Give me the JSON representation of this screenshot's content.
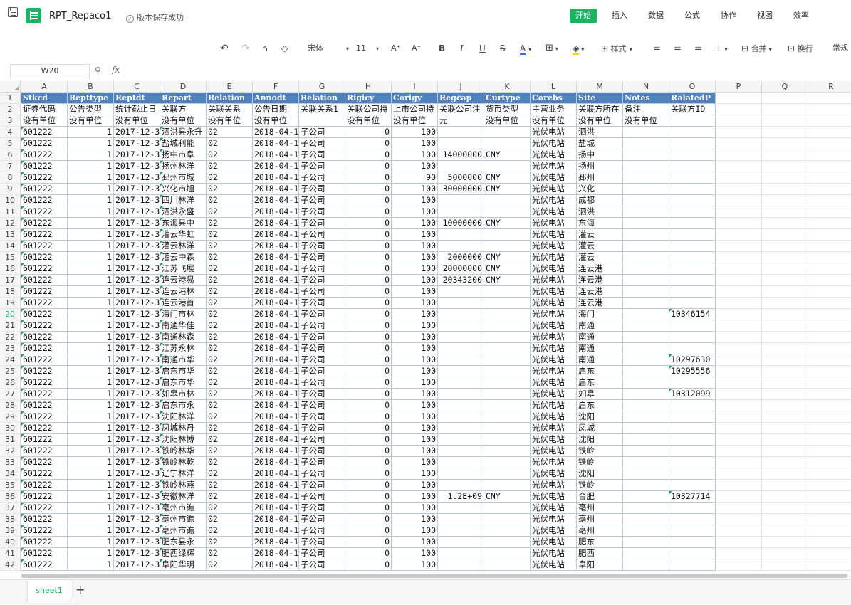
{
  "app": {
    "doc_title": "RPT_Repaco1",
    "save_status": "版本保存成功"
  },
  "menus": [
    "开始",
    "插入",
    "数据",
    "公式",
    "协作",
    "视图",
    "效率"
  ],
  "toolbar": {
    "font_name": "宋体",
    "font_size": "11",
    "font_grow": "A⁺",
    "font_shrink": "A⁻",
    "bold": "B",
    "italic": "I",
    "underline": "U",
    "strike": "S",
    "font_color": "A",
    "style_label": "样式",
    "merge_label": "合并",
    "wrap_label": "换行",
    "format_label": "常规",
    "colors": {
      "accent": "#1fb163",
      "header_fill": "#4f81bd",
      "font_color_bar": "#2f6de0",
      "fill_color_bar": "#f5d300"
    }
  },
  "formula_bar": {
    "name_box": "W20",
    "fx": "fx",
    "value": ""
  },
  "grid": {
    "columns": [
      "A",
      "B",
      "C",
      "D",
      "E",
      "F",
      "G",
      "H",
      "I",
      "J",
      "K",
      "L",
      "M",
      "N",
      "O",
      "P",
      "Q",
      "R"
    ],
    "selected_row": "20",
    "rows": [
      [
        "Stkcd",
        "Repttype",
        "Reptdt",
        "Repart",
        "Relation",
        "Annodt",
        "Relation",
        "Rigicy",
        "Corigy",
        "Regcap",
        "Curtype",
        "Corebs",
        "Site",
        "Notes",
        "RalatedP"
      ],
      [
        "证券代码",
        "公告类型",
        "统计截止日",
        "关联方",
        "关联关系",
        "公告日期",
        "关联关系1",
        "关联公司持",
        "上市公司持",
        "关联公司注",
        "货币类型",
        "主营业务",
        "关联方所在",
        "备注",
        "关联方ID"
      ],
      [
        "没有单位",
        "没有单位",
        "没有单位",
        "没有单位",
        "没有单位",
        "没有单位",
        "",
        "没有单位",
        "没有单位",
        "元",
        "没有单位",
        "没有单位",
        "没有单位",
        "没有单位",
        ""
      ],
      [
        "601222",
        "1",
        "2017-12-3",
        "泗洪县永升",
        "02",
        "2018-04-1",
        "子公司",
        "0",
        "100",
        "",
        "",
        "光伏电站",
        "泗洪",
        "",
        ""
      ],
      [
        "601222",
        "1",
        "2017-12-3",
        "盐城利能",
        "02",
        "2018-04-1",
        "子公司",
        "0",
        "100",
        "",
        "",
        "光伏电站",
        "盐城",
        "",
        ""
      ],
      [
        "601222",
        "1",
        "2017-12-3",
        "扬中市阜",
        "02",
        "2018-04-1",
        "子公司",
        "0",
        "100",
        "14000000",
        "CNY",
        "光伏电站",
        "扬中",
        "",
        ""
      ],
      [
        "601222",
        "1",
        "2017-12-3",
        "扬州林洋",
        "02",
        "2018-04-1",
        "子公司",
        "0",
        "100",
        "",
        "",
        "光伏电站",
        "扬州",
        "",
        ""
      ],
      [
        "601222",
        "1",
        "2017-12-3",
        "邳州市城",
        "02",
        "2018-04-1",
        "子公司",
        "0",
        "90",
        "5000000",
        "CNY",
        "光伏电站",
        "邳州",
        "",
        ""
      ],
      [
        "601222",
        "1",
        "2017-12-3",
        "兴化市旭",
        "02",
        "2018-04-1",
        "子公司",
        "0",
        "100",
        "30000000",
        "CNY",
        "光伏电站",
        "兴化",
        "",
        ""
      ],
      [
        "601222",
        "1",
        "2017-12-3",
        "四川林洋",
        "02",
        "2018-04-1",
        "子公司",
        "0",
        "100",
        "",
        "",
        "光伏电站",
        "成都",
        "",
        ""
      ],
      [
        "601222",
        "1",
        "2017-12-3",
        "泗洪永盛",
        "02",
        "2018-04-1",
        "子公司",
        "0",
        "100",
        "",
        "",
        "光伏电站",
        "泗洪",
        "",
        ""
      ],
      [
        "601222",
        "1",
        "2017-12-3",
        "东海县中",
        "02",
        "2018-04-1",
        "子公司",
        "0",
        "100",
        "10000000",
        "CNY",
        "光伏电站",
        "东海",
        "",
        ""
      ],
      [
        "601222",
        "1",
        "2017-12-3",
        "灌云华虹",
        "02",
        "2018-04-1",
        "子公司",
        "0",
        "100",
        "",
        "",
        "光伏电站",
        "灌云",
        "",
        ""
      ],
      [
        "601222",
        "1",
        "2017-12-3",
        "灌云林洋",
        "02",
        "2018-04-1",
        "子公司",
        "0",
        "100",
        "",
        "",
        "光伏电站",
        "灌云",
        "",
        ""
      ],
      [
        "601222",
        "1",
        "2017-12-3",
        "灌云中森",
        "02",
        "2018-04-1",
        "子公司",
        "0",
        "100",
        "2000000",
        "CNY",
        "光伏电站",
        "灌云",
        "",
        ""
      ],
      [
        "601222",
        "1",
        "2017-12-3",
        "江苏飞展",
        "02",
        "2018-04-1",
        "子公司",
        "0",
        "100",
        "20000000",
        "CNY",
        "光伏电站",
        "连云港",
        "",
        ""
      ],
      [
        "601222",
        "1",
        "2017-12-3",
        "连云港易",
        "02",
        "2018-04-1",
        "子公司",
        "0",
        "100",
        "20343200",
        "CNY",
        "光伏电站",
        "连云港",
        "",
        ""
      ],
      [
        "601222",
        "1",
        "2017-12-3",
        "连云港林",
        "02",
        "2018-04-1",
        "子公司",
        "0",
        "100",
        "",
        "",
        "光伏电站",
        "连云港",
        "",
        ""
      ],
      [
        "601222",
        "1",
        "2017-12-3",
        "连云港首",
        "02",
        "2018-04-1",
        "子公司",
        "0",
        "100",
        "",
        "",
        "光伏电站",
        "连云港",
        "",
        ""
      ],
      [
        "601222",
        "1",
        "2017-12-3",
        "海门市林",
        "02",
        "2018-04-1",
        "子公司",
        "0",
        "100",
        "",
        "",
        "光伏电站",
        "海门",
        "",
        "10346154"
      ],
      [
        "601222",
        "1",
        "2017-12-3",
        "南通华佳",
        "02",
        "2018-04-1",
        "子公司",
        "0",
        "100",
        "",
        "",
        "光伏电站",
        "南通",
        "",
        ""
      ],
      [
        "601222",
        "1",
        "2017-12-3",
        "南通林森",
        "02",
        "2018-04-1",
        "子公司",
        "0",
        "100",
        "",
        "",
        "光伏电站",
        "南通",
        "",
        ""
      ],
      [
        "601222",
        "1",
        "2017-12-3",
        "江苏永林",
        "02",
        "2018-04-1",
        "子公司",
        "0",
        "100",
        "",
        "",
        "光伏电站",
        "南通",
        "",
        ""
      ],
      [
        "601222",
        "1",
        "2017-12-3",
        "南通市华",
        "02",
        "2018-04-1",
        "子公司",
        "0",
        "100",
        "",
        "",
        "光伏电站",
        "南通",
        "",
        "10297630"
      ],
      [
        "601222",
        "1",
        "2017-12-3",
        "启东市华",
        "02",
        "2018-04-1",
        "子公司",
        "0",
        "100",
        "",
        "",
        "光伏电站",
        "启东",
        "",
        "10295556"
      ],
      [
        "601222",
        "1",
        "2017-12-3",
        "启东市华",
        "02",
        "2018-04-1",
        "子公司",
        "0",
        "100",
        "",
        "",
        "光伏电站",
        "启东",
        "",
        ""
      ],
      [
        "601222",
        "1",
        "2017-12-3",
        "如皋市林",
        "02",
        "2018-04-1",
        "子公司",
        "0",
        "100",
        "",
        "",
        "光伏电站",
        "如皋",
        "",
        "10312099"
      ],
      [
        "601222",
        "1",
        "2017-12-3",
        "启东市永",
        "02",
        "2018-04-1",
        "子公司",
        "0",
        "100",
        "",
        "",
        "光伏电站",
        "启东",
        "",
        ""
      ],
      [
        "601222",
        "1",
        "2017-12-3",
        "沈阳林洋",
        "02",
        "2018-04-1",
        "子公司",
        "0",
        "100",
        "",
        "",
        "光伏电站",
        "沈阳",
        "",
        ""
      ],
      [
        "601222",
        "1",
        "2017-12-3",
        "凤城林丹",
        "02",
        "2018-04-1",
        "子公司",
        "0",
        "100",
        "",
        "",
        "光伏电站",
        "凤城",
        "",
        ""
      ],
      [
        "601222",
        "1",
        "2017-12-3",
        "沈阳林博",
        "02",
        "2018-04-1",
        "子公司",
        "0",
        "100",
        "",
        "",
        "光伏电站",
        "沈阳",
        "",
        ""
      ],
      [
        "601222",
        "1",
        "2017-12-3",
        "铁岭林华",
        "02",
        "2018-04-1",
        "子公司",
        "0",
        "100",
        "",
        "",
        "光伏电站",
        "铁岭",
        "",
        ""
      ],
      [
        "601222",
        "1",
        "2017-12-3",
        "铁岭林乾",
        "02",
        "2018-04-1",
        "子公司",
        "0",
        "100",
        "",
        "",
        "光伏电站",
        "铁岭",
        "",
        ""
      ],
      [
        "601222",
        "1",
        "2017-12-3",
        "辽宁林洋",
        "02",
        "2018-04-1",
        "子公司",
        "0",
        "100",
        "",
        "",
        "光伏电站",
        "沈阳",
        "",
        ""
      ],
      [
        "601222",
        "1",
        "2017-12-3",
        "铁岭林燕",
        "02",
        "2018-04-1",
        "子公司",
        "0",
        "100",
        "",
        "",
        "光伏电站",
        "铁岭",
        "",
        ""
      ],
      [
        "601222",
        "1",
        "2017-12-3",
        "安徽林洋",
        "02",
        "2018-04-1",
        "子公司",
        "0",
        "100",
        "1.2E+09",
        "CNY",
        "光伏电站",
        "合肥",
        "",
        "10327714"
      ],
      [
        "601222",
        "1",
        "2017-12-3",
        "亳州市谯",
        "02",
        "2018-04-1",
        "子公司",
        "0",
        "100",
        "",
        "",
        "光伏电站",
        "亳州",
        "",
        ""
      ],
      [
        "601222",
        "1",
        "2017-12-3",
        "亳州市谯",
        "02",
        "2018-04-1",
        "子公司",
        "0",
        "100",
        "",
        "",
        "光伏电站",
        "亳州",
        "",
        ""
      ],
      [
        "601222",
        "1",
        "2017-12-3",
        "亳州市谯",
        "02",
        "2018-04-1",
        "子公司",
        "0",
        "100",
        "",
        "",
        "光伏电站",
        "亳州",
        "",
        ""
      ],
      [
        "601222",
        "1",
        "2017-12-3",
        "肥东县永",
        "02",
        "2018-04-1",
        "子公司",
        "0",
        "100",
        "",
        "",
        "光伏电站",
        "肥东",
        "",
        ""
      ],
      [
        "601222",
        "1",
        "2017-12-3",
        "肥西绿辉",
        "02",
        "2018-04-1",
        "子公司",
        "0",
        "100",
        "",
        "",
        "光伏电站",
        "肥西",
        "",
        ""
      ],
      [
        "601222",
        "1",
        "2017-12-3",
        "阜阳华明",
        "02",
        "2018-04-1",
        "子公司",
        "0",
        "100",
        "",
        "",
        "光伏电站",
        "阜阳",
        "",
        ""
      ]
    ]
  },
  "sheets": {
    "active": "sheet1",
    "add": "+"
  }
}
